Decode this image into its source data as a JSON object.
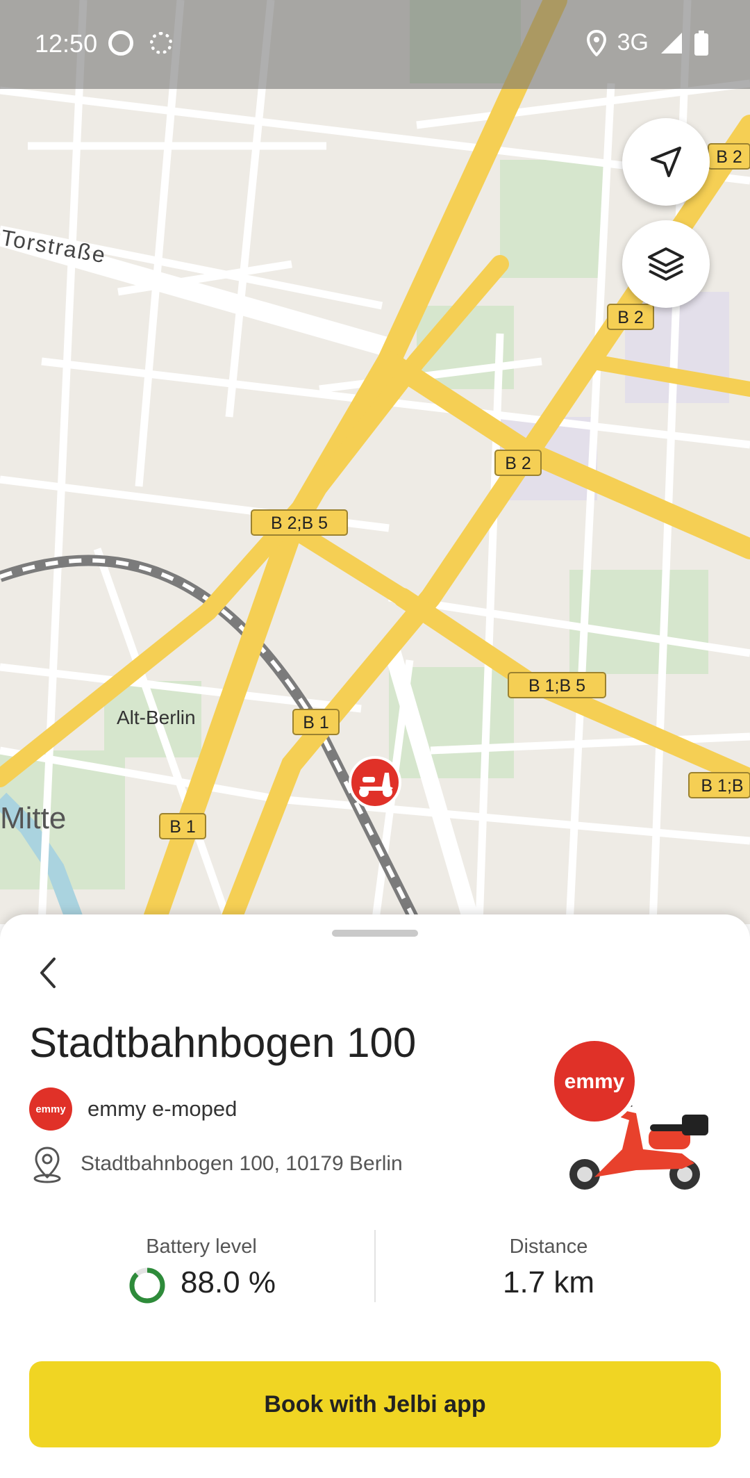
{
  "status_bar": {
    "time": "12:50",
    "network": "3G"
  },
  "map": {
    "street_labels": [
      "Torstraße",
      "Alt-Berlin",
      "Mitte"
    ],
    "road_shields": [
      "B 2",
      "B 2",
      "B 2",
      "B 2;B 5",
      "B 1;B 5",
      "B 1",
      "B 1",
      "B 1;B"
    ],
    "controls": {
      "locate_icon": "navigation-arrow-icon",
      "layers_icon": "layers-icon"
    },
    "vehicle_marker_icon": "scooter-icon",
    "colors": {
      "background": "#eeebe5",
      "major_road": "#f5cf54",
      "park": "#d6e6cd",
      "marker": "#e03128"
    }
  },
  "sheet": {
    "title": "Stadtbahnbogen 100",
    "provider": {
      "logo_text": "emmy",
      "name": "emmy e-moped"
    },
    "address": "Stadtbahnbogen 100, 10179 Berlin",
    "battery": {
      "label": "Battery level",
      "value": "88.0 %",
      "fraction": 0.88
    },
    "distance": {
      "label": "Distance",
      "value": "1.7 km"
    },
    "vehicle_image_badge": "emmy",
    "book_button_label": "Book with Jelbi app",
    "colors": {
      "button": "#f0d523",
      "battery_ring": "#2e8b3a"
    }
  }
}
